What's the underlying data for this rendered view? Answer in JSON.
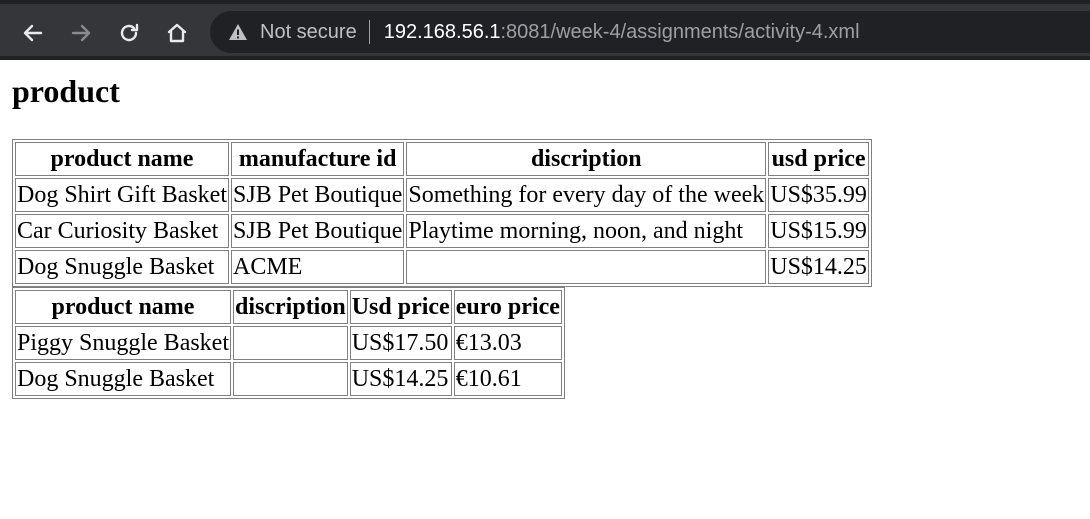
{
  "browser": {
    "security_label": "Not secure",
    "url_host": "192.168.56.1",
    "url_path": ":8081/week-4/assignments/activity-4.xml"
  },
  "page": {
    "title": "product",
    "table1": {
      "headers": [
        "product name",
        "manufacture id",
        "discription",
        "usd price"
      ],
      "rows": [
        [
          "Dog Shirt Gift Basket",
          "SJB Pet Boutique",
          "Something for every day of the week",
          "US$35.99"
        ],
        [
          "Car Curiosity Basket",
          "SJB Pet Boutique",
          "Playtime morning, noon, and night",
          "US$15.99"
        ],
        [
          "Dog Snuggle Basket",
          "ACME",
          "",
          "US$14.25"
        ]
      ]
    },
    "table2": {
      "headers": [
        "product name",
        "discription",
        "Usd price",
        "euro price"
      ],
      "rows": [
        [
          "Piggy Snuggle Basket",
          "",
          "US$17.50",
          "€13.03"
        ],
        [
          "Dog Snuggle Basket",
          "",
          "US$14.25",
          "€10.61"
        ]
      ]
    }
  }
}
